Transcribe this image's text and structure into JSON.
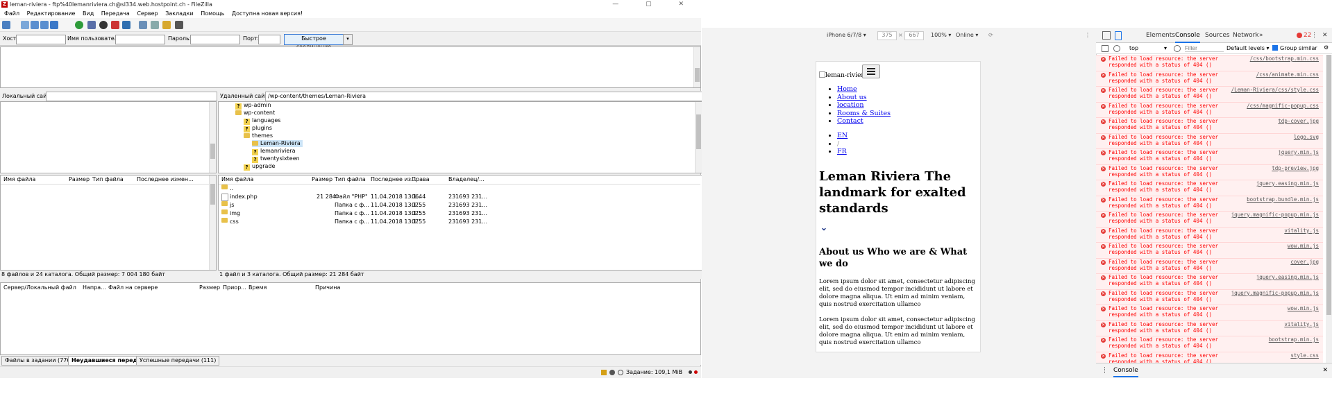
{
  "filezilla": {
    "title": "leman-riviera - ftp%40lemanriviera.ch@sl334.web.hostpoint.ch - FileZilla",
    "menu": [
      "Файл",
      "Редактирование",
      "Вид",
      "Передача",
      "Сервер",
      "Закладки",
      "Помощь",
      "Доступна новая версия!"
    ],
    "quickconnect": {
      "host_label": "Хост:",
      "user_label": "Имя пользователя",
      "pass_label": "Пароль:",
      "port_label": "Порт:",
      "button": "Быстрое соединение"
    },
    "local_site_label": "Локальный сайт:",
    "remote_site_label": "Удаленный сайт:",
    "remote_path": "/wp-content/themes/Leman-Riviera",
    "remote_tree": [
      {
        "name": "wp-admin",
        "type": "q"
      },
      {
        "name": "wp-content",
        "type": "folder"
      },
      {
        "name": "languages",
        "type": "q"
      },
      {
        "name": "plugins",
        "type": "q"
      },
      {
        "name": "themes",
        "type": "folder"
      },
      {
        "name": "Leman-Riviera",
        "type": "folder"
      },
      {
        "name": "lemanriviera",
        "type": "q"
      },
      {
        "name": "twentysixteen",
        "type": "q"
      },
      {
        "name": "upgrade",
        "type": "q"
      }
    ],
    "local_columns": [
      "Имя файла",
      "Размер",
      "Тип файла",
      "Последнее измен..."
    ],
    "remote_columns": [
      "Имя файла",
      "Размер",
      "Тип файла",
      "Последнее из...",
      "Права",
      "Владелец/..."
    ],
    "remote_files": [
      {
        "name": "..",
        "size": "",
        "type": "",
        "modified": "",
        "perms": "",
        "owner": ""
      },
      {
        "name": "index.php",
        "size": "21 284",
        "type": "Файл \"PHP\"",
        "modified": "11.04.2018 13:1...",
        "perms": "0644",
        "owner": "231693 231..."
      },
      {
        "name": "js",
        "size": "",
        "type": "Папка с ф...",
        "modified": "11.04.2018 13:1...",
        "perms": "0755",
        "owner": "231693 231..."
      },
      {
        "name": "img",
        "size": "",
        "type": "Папка с ф...",
        "modified": "11.04.2018 13:1...",
        "perms": "0755",
        "owner": "231693 231..."
      },
      {
        "name": "css",
        "size": "",
        "type": "Папка с ф...",
        "modified": "11.04.2018 13:1...",
        "perms": "0755",
        "owner": "231693 231..."
      }
    ],
    "local_status": "8 файлов и 24 каталога. Общий размер: 7 004 180 байт",
    "remote_status": "1 файл и 3 каталога. Общий размер: 21 284 байт",
    "queue_columns": [
      "Сервер/Локальный файл",
      "Напра...",
      "Файл на сервере",
      "Размер",
      "Приор...",
      "Время",
      "Причина"
    ],
    "queue_tabs": [
      "Файлы в задании (776)",
      "Неудавшиеся передачи",
      "Успешные передачи (111)"
    ],
    "status_task": "Задание: 109,1 MiB"
  },
  "device_toolbar": {
    "device": "iPhone 6/7/8",
    "width": "375",
    "height": "667",
    "zoom": "100%",
    "network": "Online"
  },
  "mobile_page": {
    "logo_alt": "leman-riviera",
    "nav": [
      "Home",
      "About us",
      "location",
      "Rooms & Suites",
      "Contact"
    ],
    "lang": [
      "EN",
      "/",
      "FR"
    ],
    "hero_title": "Leman Riviera The landmark for exalted standards",
    "chevron": "⌄",
    "about_title": "About us Who we are & What we do",
    "para1": "Lorem ipsum dolor sit amet, consectetur adipiscing elit, sed do eiusmod tempor incididunt ut labore et dolore magna aliqua. Ut enim ad minim veniam, quis nostrud exercitation ullamco",
    "para2": "Lorem ipsum dolor sit amet, consectetur adipiscing elit, sed do eiusmod tempor incididunt ut labore et dolore magna aliqua. Ut enim ad minim veniam, quis nostrud exercitation ullamco"
  },
  "devtools": {
    "tabs": [
      "Elements",
      "Console",
      "Sources",
      "Network",
      "»"
    ],
    "error_count": "22",
    "context": "top",
    "filter_placeholder": "Filter",
    "levels": "Default levels",
    "group_similar": "Group similar",
    "errors": [
      {
        "msg": "Failed to load resource: the server responded with a status of 404 ()",
        "src": "/css/bootstrap.min.css"
      },
      {
        "msg": "Failed to load resource: the server responded with a status of 404 ()",
        "src": "/css/animate.min.css"
      },
      {
        "msg": "Failed to load resource: the server responded with a status of 404 ()",
        "src": "/Leman-Riviera/css/style.css"
      },
      {
        "msg": "Failed to load resource: the server responded with a status of 404 ()",
        "src": "/css/magnific-popup.css"
      },
      {
        "msg": "Failed to load resource: the server responded with a status of 404 ()",
        "src": "tdp-cover.jpg"
      },
      {
        "msg": "Failed to load resource: the server responded with a status of 404 ()",
        "src": "logo.svg"
      },
      {
        "msg": "Failed to load resource: the server responded with a status of 404 ()",
        "src": "jquery.min.js"
      },
      {
        "msg": "Failed to load resource: the server responded with a status of 404 ()",
        "src": "tdp-preview.jpg"
      },
      {
        "msg": "Failed to load resource: the server responded with a status of 404 ()",
        "src": "jquery.easing.min.js"
      },
      {
        "msg": "Failed to load resource: the server responded with a status of 404 ()",
        "src": "bootstrap.bundle.min.js"
      },
      {
        "msg": "Failed to load resource: the server responded with a status of 404 ()",
        "src": "jquery.magnific-popup.min.js"
      },
      {
        "msg": "Failed to load resource: the server responded with a status of 404 ()",
        "src": "vitality.js"
      },
      {
        "msg": "Failed to load resource: the server responded with a status of 404 ()",
        "src": "wow.min.js"
      },
      {
        "msg": "Failed to load resource: the server responded with a status of 404 ()",
        "src": "cover.jpg"
      },
      {
        "msg": "Failed to load resource: the server responded with a status of 404 ()",
        "src": "jquery.easing.min.js"
      },
      {
        "msg": "Failed to load resource: the server responded with a status of 404 ()",
        "src": "jquery.magnific-popup.min.js"
      },
      {
        "msg": "Failed to load resource: the server responded with a status of 404 ()",
        "src": "wow.min.js"
      },
      {
        "msg": "Failed to load resource: the server responded with a status of 404 ()",
        "src": "vitality.js"
      },
      {
        "msg": "Failed to load resource: the server responded with a status of 404 ()",
        "src": "bootstrap.min.js"
      },
      {
        "msg": "Failed to load resource: the server responded with a status of 404 ()",
        "src": "style.css"
      }
    ],
    "drawer_tab": "Console"
  },
  "colors": {
    "error_text": "#ff0000",
    "error_bg": "#fff0f0",
    "link": "#0000ee",
    "accent": "#1a73e8"
  }
}
